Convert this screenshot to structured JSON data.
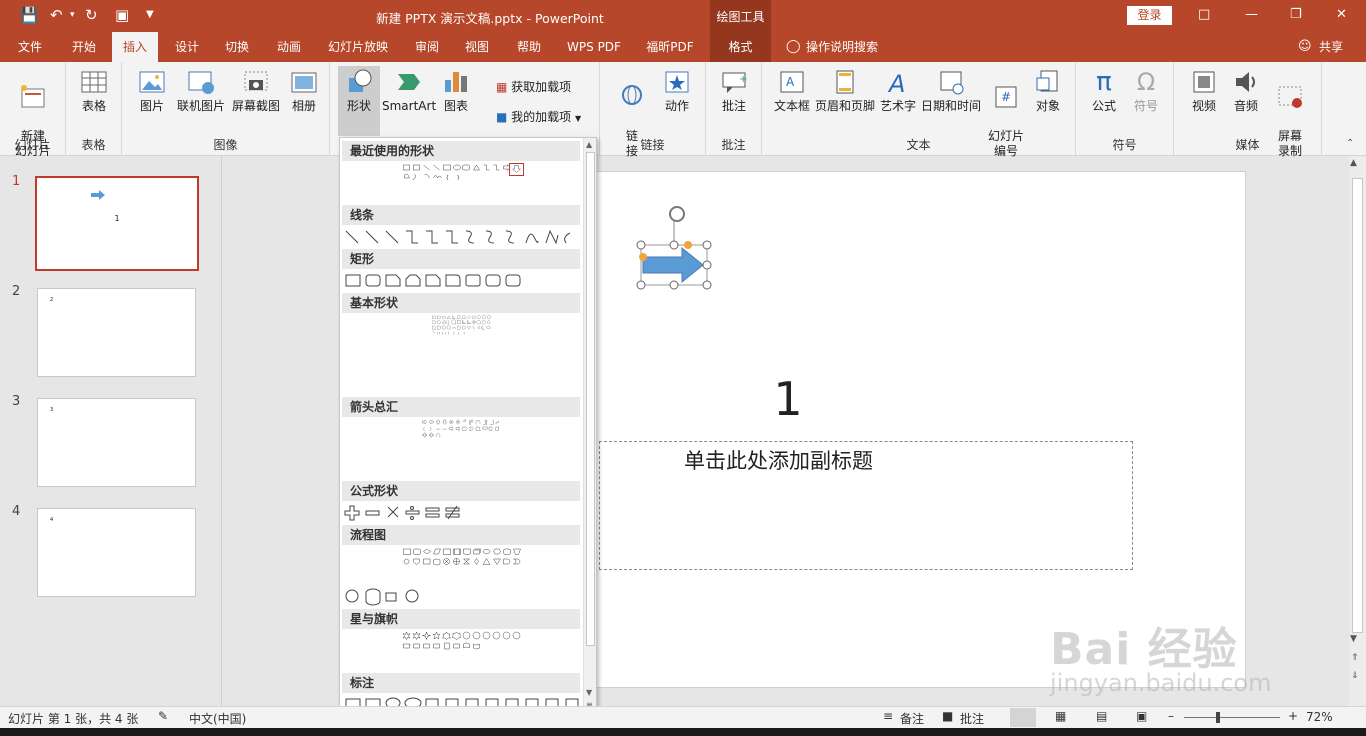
{
  "window": {
    "title": "新建 PPTX 演示文稿.pptx  -  PowerPoint",
    "context_title": "绘图工具",
    "login": "登录"
  },
  "tabs": [
    "文件",
    "开始",
    "插入",
    "设计",
    "切换",
    "动画",
    "幻灯片放映",
    "审阅",
    "视图",
    "帮助",
    "WPS PDF",
    "福昕PDF",
    "格式"
  ],
  "tell_me": "操作说明搜索",
  "share": "共享",
  "ribbon": {
    "new_slide": "新建\n幻灯片",
    "group_slides": "幻灯片",
    "table": "表格",
    "group_tables": "表格",
    "picture": "图片",
    "online_picture": "联机图片",
    "screenshot": "屏幕截图",
    "album": "相册",
    "group_images": "图像",
    "shapes": "形状",
    "smartart": "SmartArt",
    "chart": "图表",
    "get_addins": "获取加载项",
    "my_addins": "我的加载项",
    "link": "链\n接",
    "action": "动作",
    "group_links": "链接",
    "comment": "批注",
    "group_comments": "批注",
    "textbox": "文本框",
    "header_footer": "页眉和页脚",
    "wordart": "艺术字",
    "datetime": "日期和时间",
    "slide_number": "幻灯片\n编号",
    "object": "对象",
    "group_text": "文本",
    "equation": "公式",
    "symbol": "符号",
    "group_symbols": "符号",
    "video": "视频",
    "audio": "音频",
    "screen_record": "屏幕\n录制",
    "group_media": "媒体"
  },
  "shapes_menu": {
    "categories": [
      "最近使用的形状",
      "线条",
      "矩形",
      "基本形状",
      "箭头总汇",
      "公式形状",
      "流程图",
      "星与旗帜",
      "标注"
    ]
  },
  "slides": [
    {
      "num": "1",
      "text": "1"
    },
    {
      "num": "2",
      "text": "2"
    },
    {
      "num": "3",
      "text": "3"
    },
    {
      "num": "4",
      "text": "4"
    }
  ],
  "slide": {
    "title": "1",
    "subtitle": "单击此处添加副标题"
  },
  "status": {
    "slide_info": "幻灯片 第 1 张，共 4 张",
    "language": "中文(中国)",
    "notes": "备注",
    "comments": "批注",
    "zoom": "72%"
  },
  "watermark": {
    "text": "Bai  经验",
    "url": "jingyan.baidu.com"
  },
  "colors": {
    "accent": "#b7472a",
    "accent_dark": "#95371f",
    "arrow": "#5b9bd5",
    "handle": "#f2a33a"
  }
}
